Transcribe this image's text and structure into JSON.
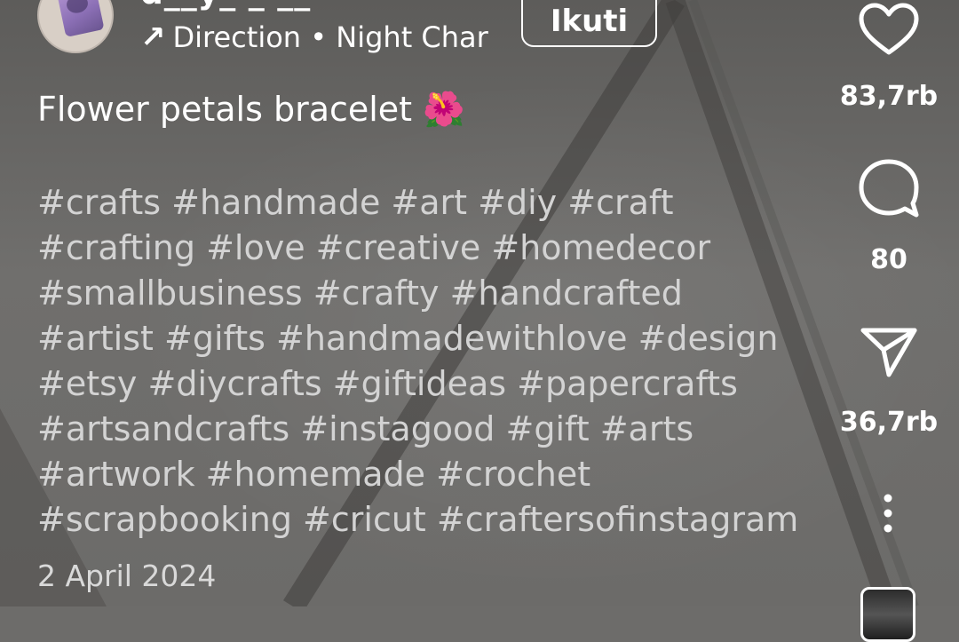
{
  "header": {
    "username": "d__y_ _ __",
    "music_arrow": "↗",
    "music_text": "Direction • Night Char",
    "follow_label": "Ikuti"
  },
  "caption": {
    "title": "Flower petals bracelet 🌺",
    "hashtag_lines": [
      "#crafts #handmade #art #diy #craft",
      "#crafting #love #creative #homedecor",
      "#smallbusiness #crafty #handcrafted",
      "#artist #gifts #handmadewithlove #design",
      "#etsy #diycrafts #giftideas #papercrafts",
      "#artsandcrafts #instagood #gift #arts",
      "#artwork #homemade #crochet",
      "#scrapbooking #cricut #craftersofinstagram"
    ],
    "date": "2 April 2024"
  },
  "actions": {
    "likes": "83,7rb",
    "comments": "80",
    "shares": "36,7rb"
  },
  "icons": {
    "like": "heart-icon",
    "comment": "comment-bubble-icon",
    "share": "paper-plane-icon",
    "more": "more-vertical-icon",
    "audio": "audio-thumbnail"
  }
}
